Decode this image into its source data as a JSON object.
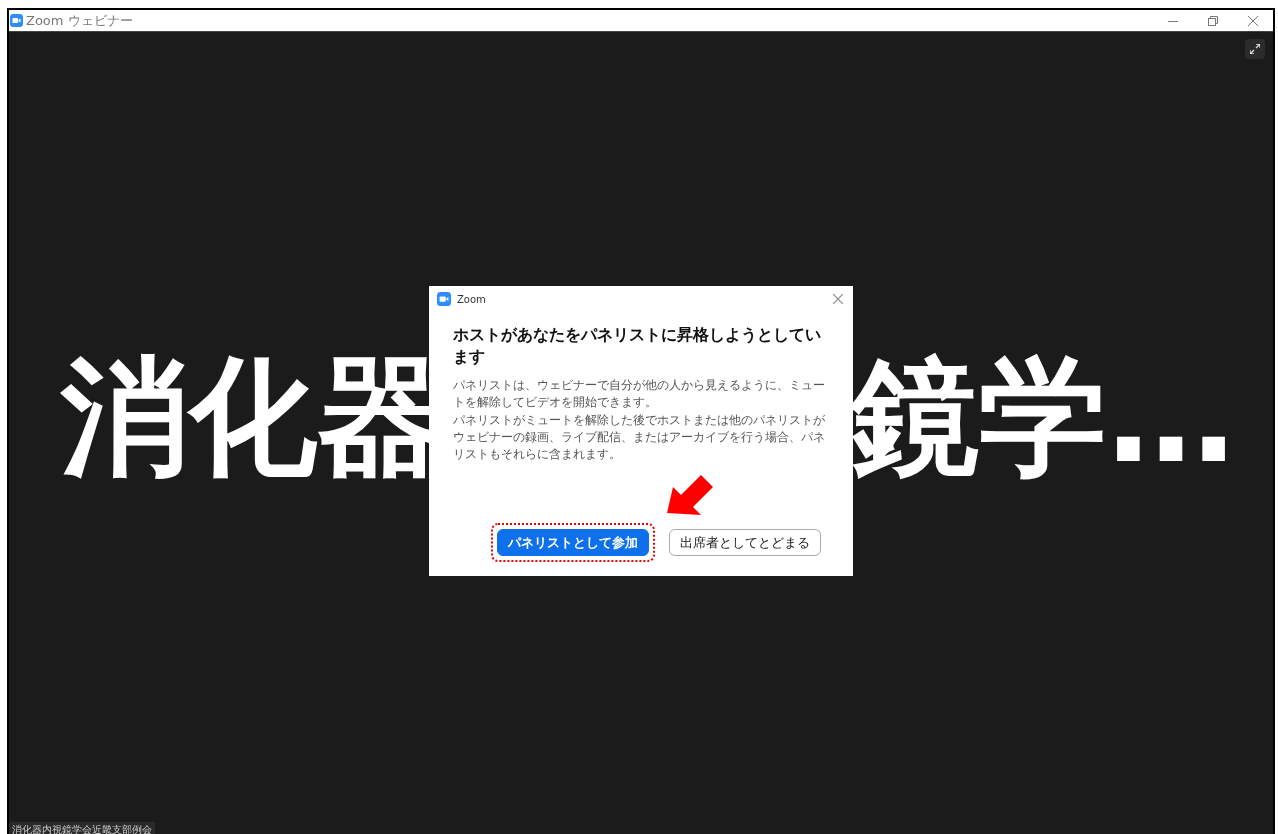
{
  "window": {
    "title": "Zoom ウェビナー"
  },
  "stage": {
    "shared_text_left": "消化器",
    "shared_text_right": "鏡学…",
    "name_label": "消化器内視鏡学会近畿支部例会"
  },
  "dialog": {
    "title": "Zoom",
    "heading": "ホストがあなたをパネリストに昇格しようとしています",
    "paragraphs": [
      "パネリストは、ウェビナーで自分が他の人から見えるように、ミュートを解除してビデオを開始できます。",
      "パネリストがミュートを解除した後でホストまたは他のパネリストがウェビナーの録画、ライブ配信、またはアーカイブを行う場合、パネリストもそれらに含まれます。"
    ],
    "buttons": [
      {
        "label": "パネリストとして参加",
        "kind": "primary",
        "highlighted": true
      },
      {
        "label": "出席者としてとどまる",
        "kind": "secondary",
        "highlighted": false
      }
    ]
  }
}
